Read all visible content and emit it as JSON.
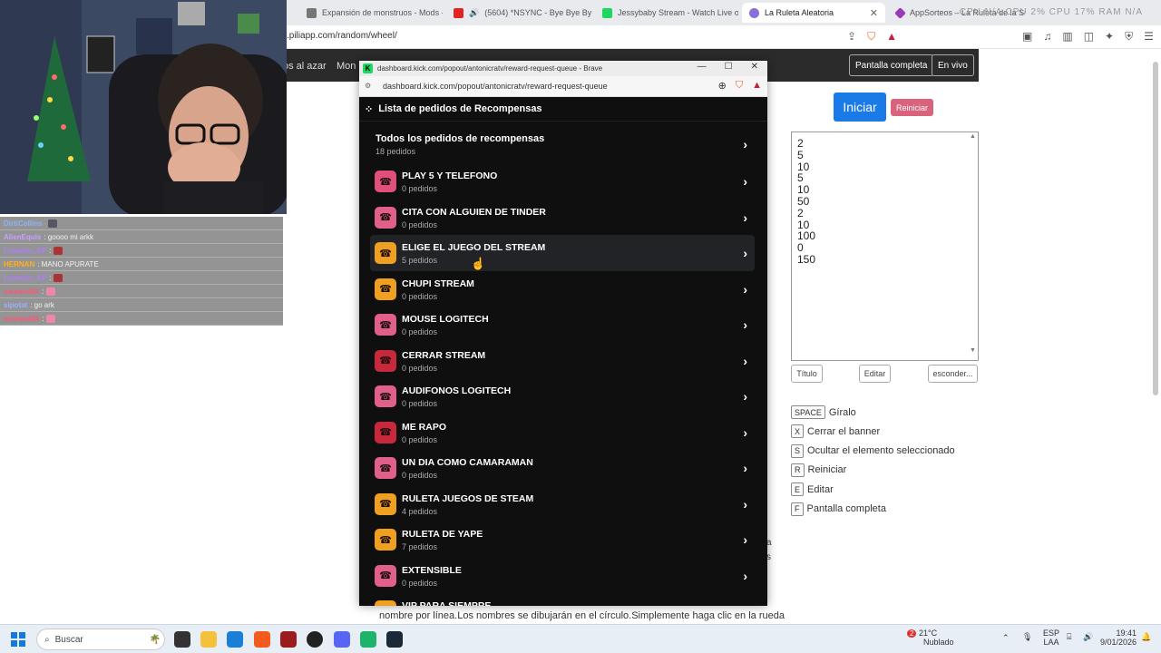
{
  "tabs": [
    {
      "label": "Expansión de monstruos - Mods - M",
      "color": "#777777"
    },
    {
      "label": "(5604) *NSYNC - Bye Bye Bye (O",
      "color": "#e02424"
    },
    {
      "label": "Jessybaby Stream - Watch Live on K",
      "color": "#1ed760"
    },
    {
      "label": "La Ruleta Aleatoria",
      "color": "#8a6fd8"
    },
    {
      "label": "AppSorteos – La Ruleta de la Suerte",
      "color": "#9a3ab8"
    }
  ],
  "window_stats": "CPU N/A    CPU 2%    CPU 17%    RAM N/A",
  "address": {
    "url": ".piliapp.com/random/wheel/"
  },
  "page": {
    "nav_link_1": "os al azar",
    "nav_link_2": "Mon",
    "fullscreen_label": "Pantalla completa",
    "live_label": "En vivo",
    "start_label": "Iniciar",
    "reset_label": "Reiniciar",
    "names": [
      "2",
      "5",
      "10",
      "5",
      "10",
      "50",
      "2",
      "10",
      "100",
      "0",
      "150"
    ],
    "title_btn": "Título",
    "edit_btn": "Editar",
    "hide_btn": "esconder...",
    "shortcuts": [
      {
        "key": "SPACE",
        "label": "Gíralo"
      },
      {
        "key": "X",
        "label": "Cerrar el banner"
      },
      {
        "key": "S",
        "label": "Ocultar el elemento seleccionado"
      },
      {
        "key": "R",
        "label": "Reiniciar"
      },
      {
        "key": "E",
        "label": "Editar"
      },
      {
        "key": "F",
        "label": "Pantalla completa"
      }
    ],
    "footer_text": "nombre por línea.Los nombres se dibujarán en el círculo.Simplemente haga clic en la rueda",
    "stray_1": "a",
    "stray_2": "s"
  },
  "chat": [
    {
      "user": "DirtiCollins",
      "msg": "",
      "color": "#8ab4ff",
      "emote": "#556"
    },
    {
      "user": "AlienEquis",
      "msg": ": goooo mi arkk",
      "color": "#c8a0ff",
      "emote": ""
    },
    {
      "user": "Leandro_AP",
      "msg": ":",
      "color": "#b07cff",
      "emote": "#a33"
    },
    {
      "user": "HERNAN",
      "msg": ": MANO APURATE",
      "color": "#ffb020",
      "emote": ""
    },
    {
      "user": "Leandro_AP",
      "msg": ":",
      "color": "#b07cff",
      "emote": "#a33"
    },
    {
      "user": "samqsd24",
      "msg": ":",
      "color": "#ff5577",
      "emote": "#e8a"
    },
    {
      "user": "sipotat",
      "msg": ": go ark",
      "color": "#9ab0ff",
      "emote": ""
    },
    {
      "user": "samqsd24",
      "msg": ":",
      "color": "#ff5577",
      "emote": "#e8a"
    }
  ],
  "popup": {
    "title": "dashboard.kick.com/popout/antonicratv/reward-request-queue - Brave",
    "url": "dashboard.kick.com/popout/antonicratv/reward-request-queue",
    "header": "Lista de pedidos de Recompensas",
    "all_title": "Todos los pedidos de recompensas",
    "all_count": "18 pedidos",
    "rewards": [
      {
        "name": "PLAY 5 Y TELEFONO",
        "count": "0 pedidos",
        "color": "#e0507a"
      },
      {
        "name": "CITA CON ALGUIEN DE TINDER",
        "count": "0 pedidos",
        "color": "#e0608a"
      },
      {
        "name": "ELIGE EL JUEGO DEL STREAM",
        "count": "5 pedidos",
        "color": "#f0a020"
      },
      {
        "name": "CHUPI STREAM",
        "count": "0 pedidos",
        "color": "#f0a020"
      },
      {
        "name": "MOUSE LOGITECH",
        "count": "0 pedidos",
        "color": "#e0608a"
      },
      {
        "name": "CERRAR STREAM",
        "count": "0 pedidos",
        "color": "#c8283c"
      },
      {
        "name": "AUDIFONOS LOGITECH",
        "count": "0 pedidos",
        "color": "#e0608a"
      },
      {
        "name": "ME RAPO",
        "count": "0 pedidos",
        "color": "#c8283c"
      },
      {
        "name": "UN DIA COMO CAMARAMAN",
        "count": "0 pedidos",
        "color": "#e0608a"
      },
      {
        "name": "RULETA JUEGOS DE STEAM",
        "count": "4 pedidos",
        "color": "#f0a020"
      },
      {
        "name": "RULETA DE YAPE",
        "count": "7 pedidos",
        "color": "#f0a020"
      },
      {
        "name": "EXTENSIBLE",
        "count": "0 pedidos",
        "color": "#e0608a"
      },
      {
        "name": "VIP PARA SIEMPRE",
        "count": "",
        "color": "#f0a020"
      }
    ]
  },
  "taskbar": {
    "search_placeholder": "Buscar",
    "weather_temp": "21°C",
    "weather_desc": "Nublado",
    "lang": "ESP",
    "lang2": "LAA",
    "time": "19:41",
    "date": "9/01/2026",
    "weather_badge": "2"
  }
}
